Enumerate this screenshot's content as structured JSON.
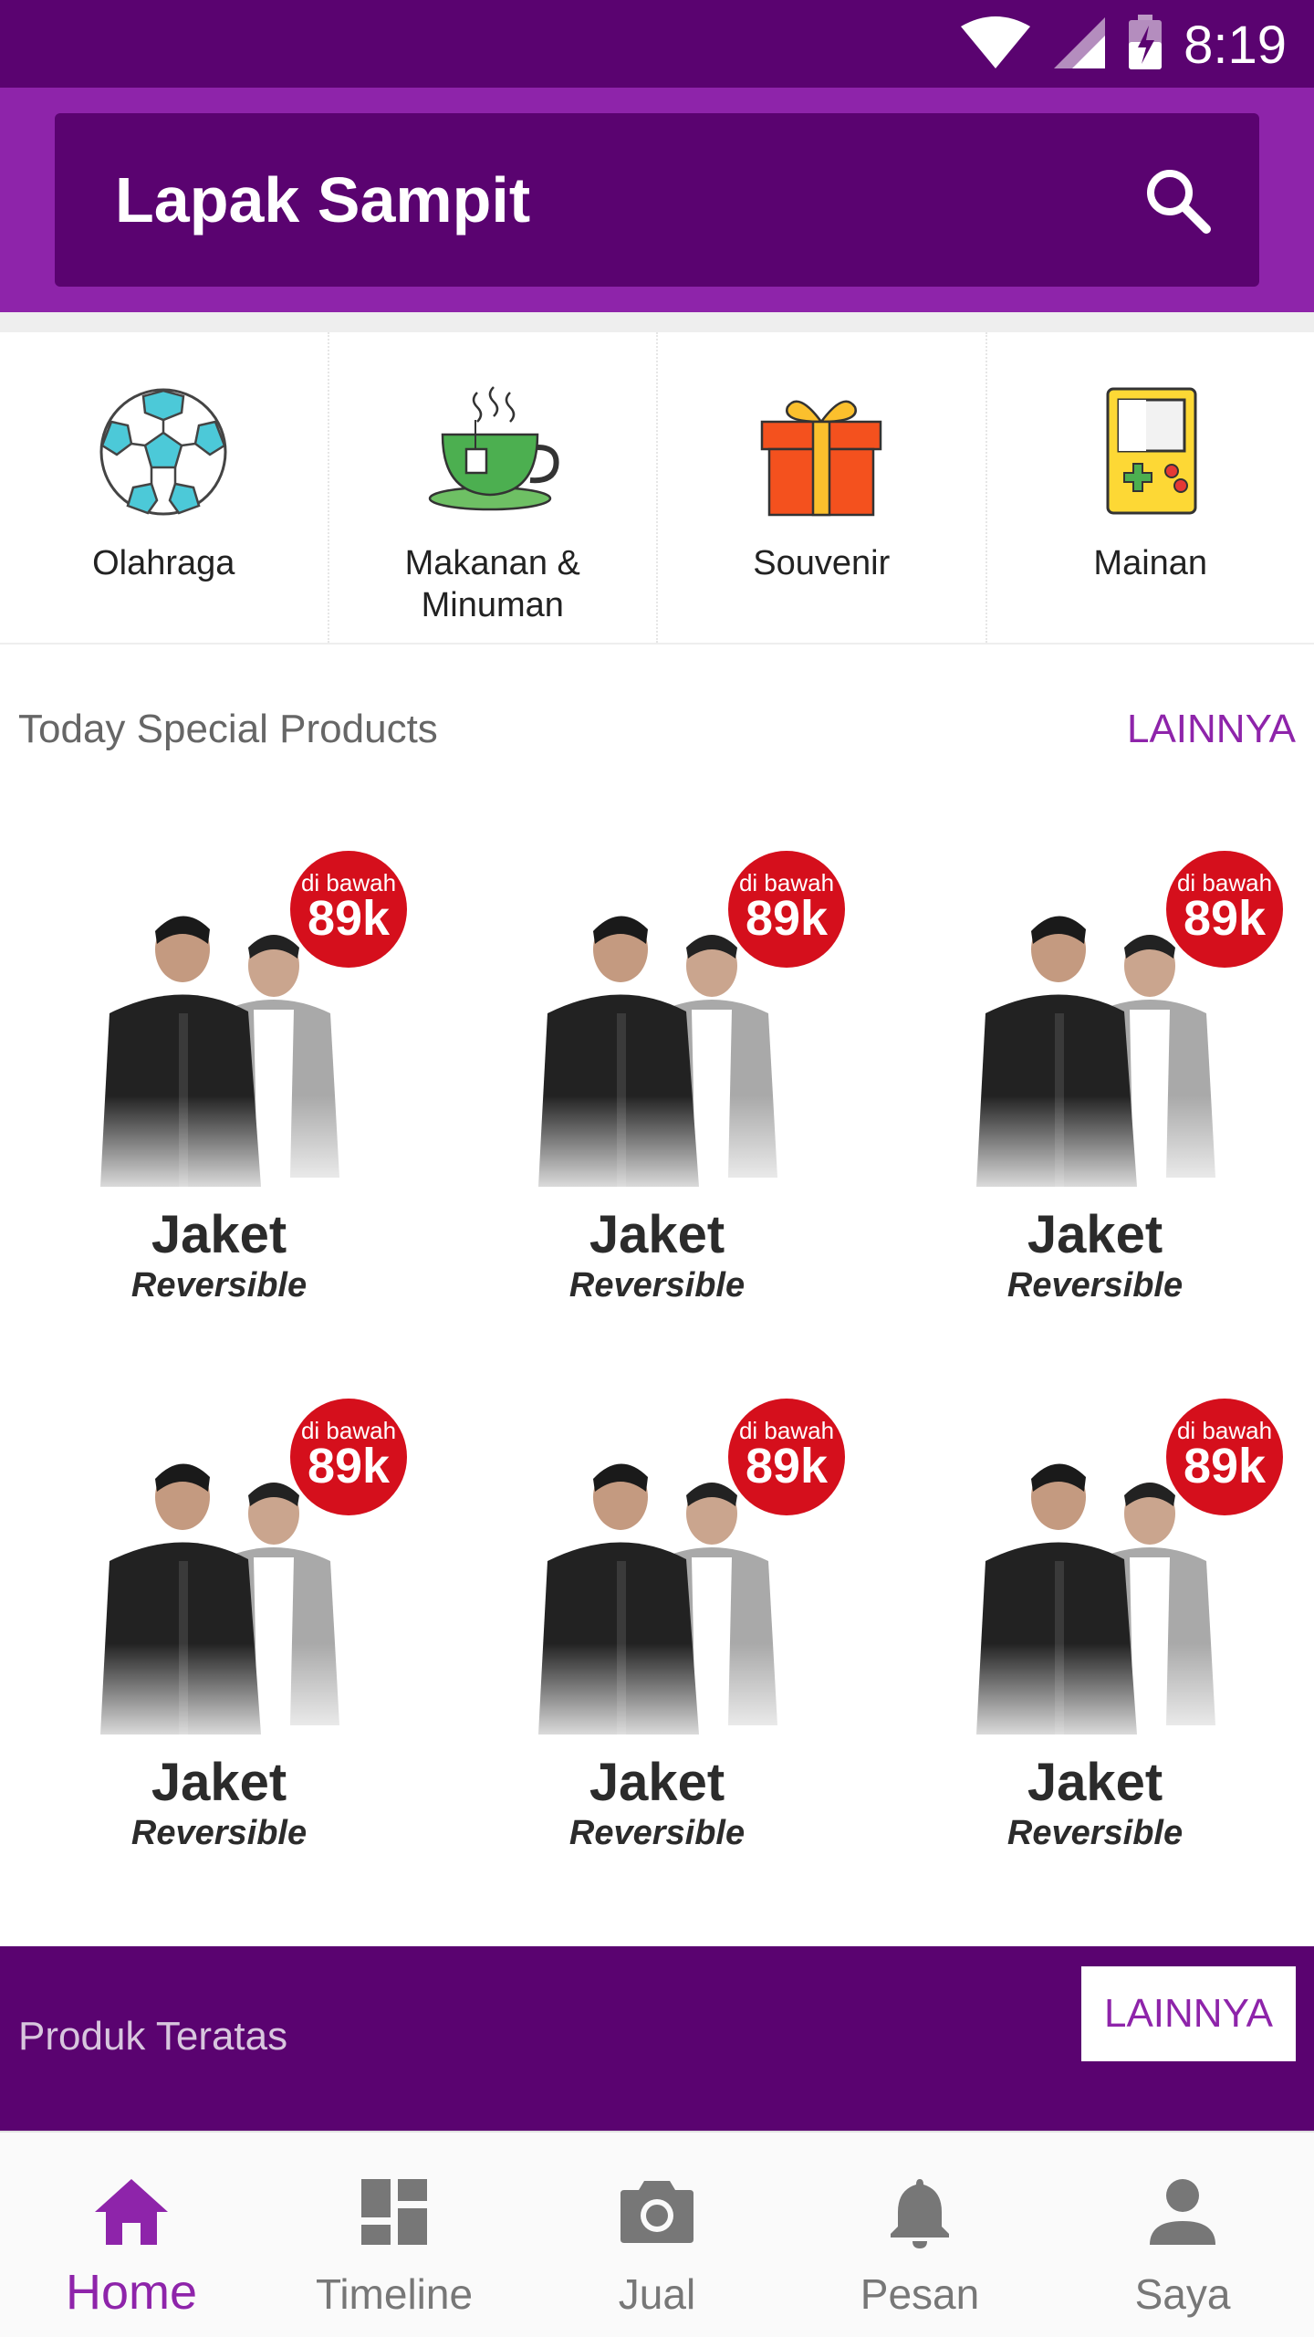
{
  "status_bar": {
    "time": "8:19",
    "icons": [
      "wifi-icon",
      "cellular-signal-icon",
      "battery-charging-icon"
    ]
  },
  "app_bar": {
    "title": "Lapak Sampit",
    "search_icon": "search-icon"
  },
  "categories": [
    {
      "label": "Olahraga",
      "icon": "soccer-ball-icon"
    },
    {
      "label": "Makanan & Minuman",
      "icon": "tea-cup-icon"
    },
    {
      "label": "Souvenir",
      "icon": "gift-box-icon"
    },
    {
      "label": "Mainan",
      "icon": "handheld-game-icon"
    }
  ],
  "today_special": {
    "title": "Today Special Products",
    "more_label": "LAINNYA",
    "products": [
      {
        "badge_top": "di bawah",
        "badge_price": "89k",
        "name": "Jaket",
        "subtitle": "Reversible"
      },
      {
        "badge_top": "di bawah",
        "badge_price": "89k",
        "name": "Jaket",
        "subtitle": "Reversible"
      },
      {
        "badge_top": "di bawah",
        "badge_price": "89k",
        "name": "Jaket",
        "subtitle": "Reversible"
      },
      {
        "badge_top": "di bawah",
        "badge_price": "89k",
        "name": "Jaket",
        "subtitle": "Reversible"
      },
      {
        "badge_top": "di bawah",
        "badge_price": "89k",
        "name": "Jaket",
        "subtitle": "Reversible"
      },
      {
        "badge_top": "di bawah",
        "badge_price": "89k",
        "name": "Jaket",
        "subtitle": "Reversible"
      }
    ]
  },
  "top_products": {
    "title": "Produk Teratas",
    "more_label": "LAINNYA"
  },
  "bottom_nav": [
    {
      "label": "Home",
      "icon": "home-icon",
      "active": true
    },
    {
      "label": "Timeline",
      "icon": "dashboard-icon",
      "active": false
    },
    {
      "label": "Jual",
      "icon": "camera-icon",
      "active": false
    },
    {
      "label": "Pesan",
      "icon": "bell-icon",
      "active": false
    },
    {
      "label": "Saya",
      "icon": "person-icon",
      "active": false
    }
  ],
  "colors": {
    "primary_dark": "#5a0370",
    "primary": "#8e24aa",
    "badge_red": "#d50f1c"
  }
}
